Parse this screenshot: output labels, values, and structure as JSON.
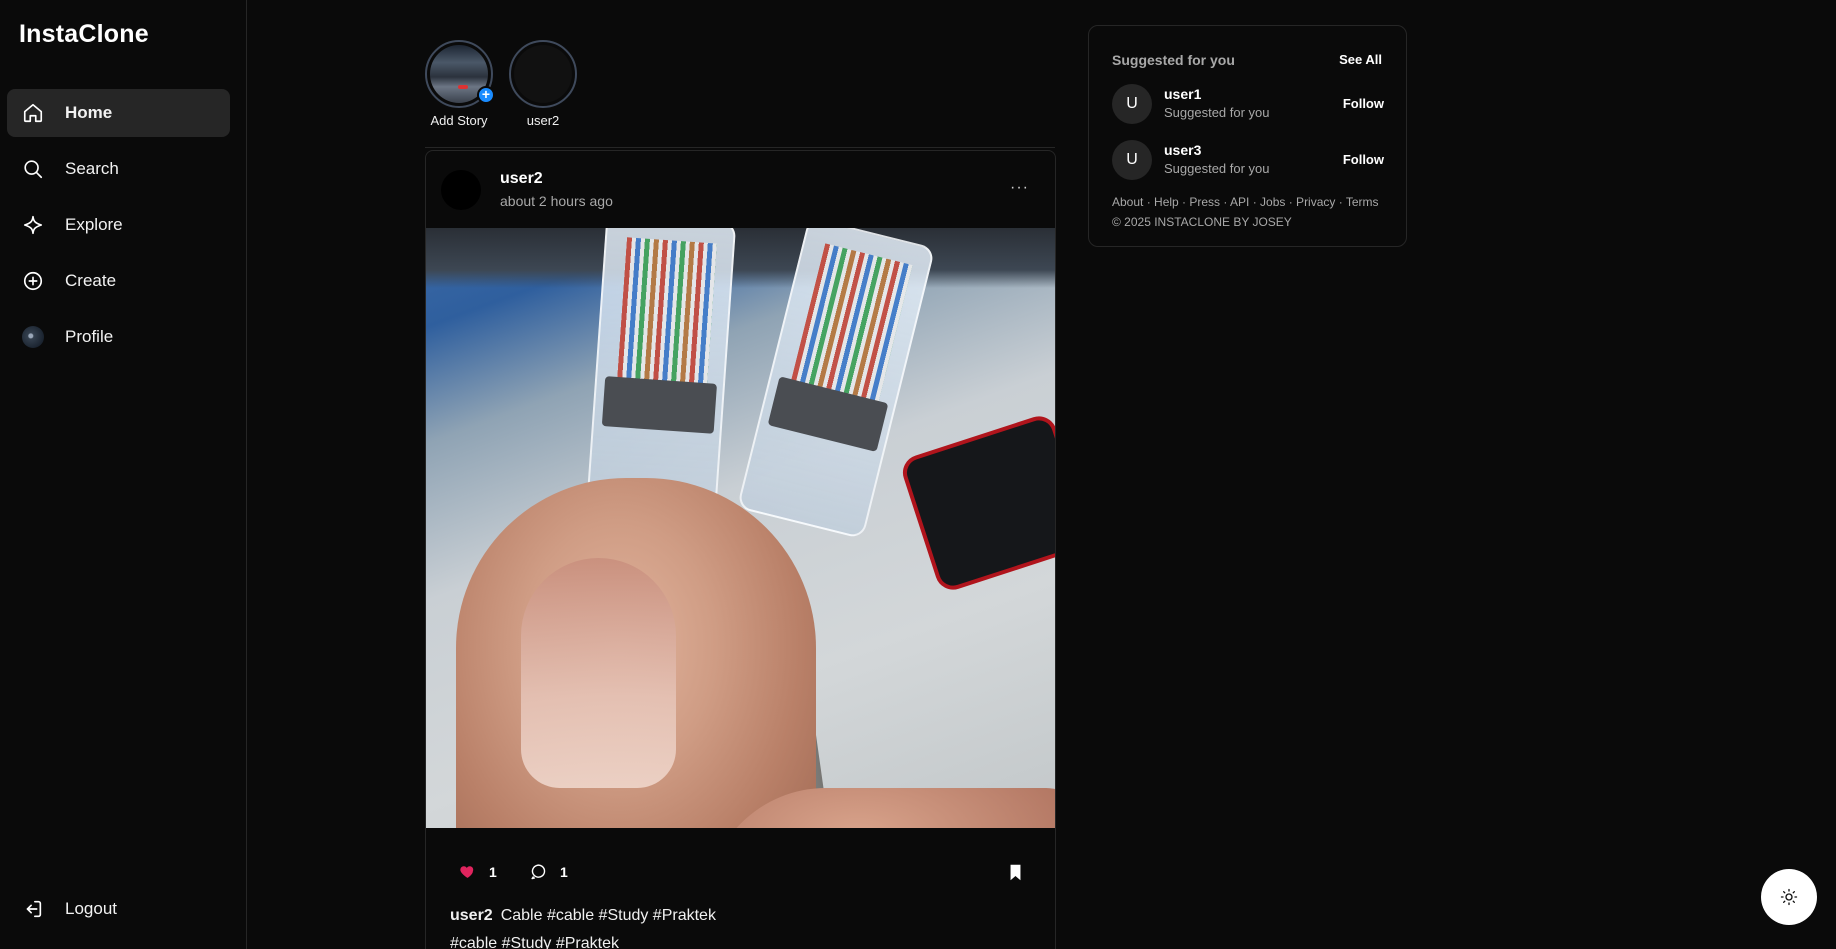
{
  "app": {
    "title": "InstaClone"
  },
  "sidebar": {
    "items": [
      {
        "label": "Home",
        "icon": "home-icon",
        "active": true
      },
      {
        "label": "Search",
        "icon": "search-icon"
      },
      {
        "label": "Explore",
        "icon": "explore-icon"
      },
      {
        "label": "Create",
        "icon": "create-icon"
      },
      {
        "label": "Profile",
        "icon": "profile-avatar"
      }
    ],
    "logout": "Logout"
  },
  "stories": [
    {
      "name": "Add Story",
      "icon": "plus-icon"
    },
    {
      "name": "user2"
    }
  ],
  "post": {
    "username": "user2",
    "time": "about 2 hours ago",
    "more": "···",
    "likes": "1",
    "comments": "1",
    "caption_user": "user2",
    "caption_text": "Cable #cable #Study #Praktek",
    "tags_line": "#cable #Study #Praktek",
    "like_color": "#e0245e"
  },
  "suggestions": {
    "title": "Suggested for you",
    "see_all": "See All",
    "users": [
      {
        "initial": "U",
        "name": "user1",
        "sub": "Suggested for you",
        "action": "Follow"
      },
      {
        "initial": "U",
        "name": "user3",
        "sub": "Suggested for you",
        "action": "Follow"
      }
    ],
    "links": "About · Help · Press · API · Jobs · Privacy · Terms",
    "copyright": "© 2025 INSTACLONE BY JOSEY"
  },
  "theme_toggle": {
    "icon": "sun-icon"
  }
}
